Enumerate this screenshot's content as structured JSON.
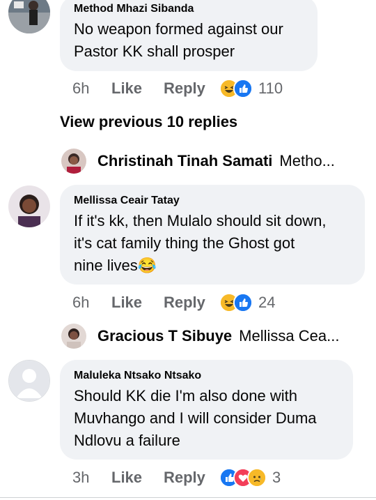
{
  "comments": [
    {
      "author": "Method Mhazi Sibanda",
      "text_lines": [
        "No weapon formed against our",
        "Pastor KK shall prosper"
      ],
      "time": "6h",
      "like_label": "Like",
      "reply_label": "Reply",
      "reaction_icons": [
        "haha-icon",
        "like-icon"
      ],
      "reaction_count": "110"
    },
    {
      "author": "Mellissa Ceair Tatay",
      "text_lines": [
        "If it's kk, then Mulalo should sit down,",
        "it's cat family thing  the Ghost got",
        "nine lives😂"
      ],
      "time": "6h",
      "like_label": "Like",
      "reply_label": "Reply",
      "reaction_icons": [
        "haha-icon",
        "like-icon"
      ],
      "reaction_count": "24"
    },
    {
      "author": "Maluleka Ntsako Ntsako",
      "text_lines": [
        "Should KK die I'm also done with",
        "Muvhango and I will consider Duma",
        "Ndlovu a failure"
      ],
      "time": "3h",
      "like_label": "Like",
      "reply_label": "Reply",
      "reaction_icons": [
        "like-icon",
        "love-icon",
        "sad-icon"
      ],
      "reaction_count": "3"
    }
  ],
  "view_previous": "View previous 10 replies",
  "reply_previews": [
    {
      "name": "Christinah Tinah Samati",
      "text": "Metho..."
    },
    {
      "name": "Gracious T Sibuye",
      "text": "Mellissa Cea..."
    }
  ],
  "colors": {
    "bubble": "#f0f2f5",
    "meta": "#65676b",
    "like_blue": "#1877f2",
    "love_red": "#f33e58",
    "haha_yellow": "#f7b928"
  }
}
